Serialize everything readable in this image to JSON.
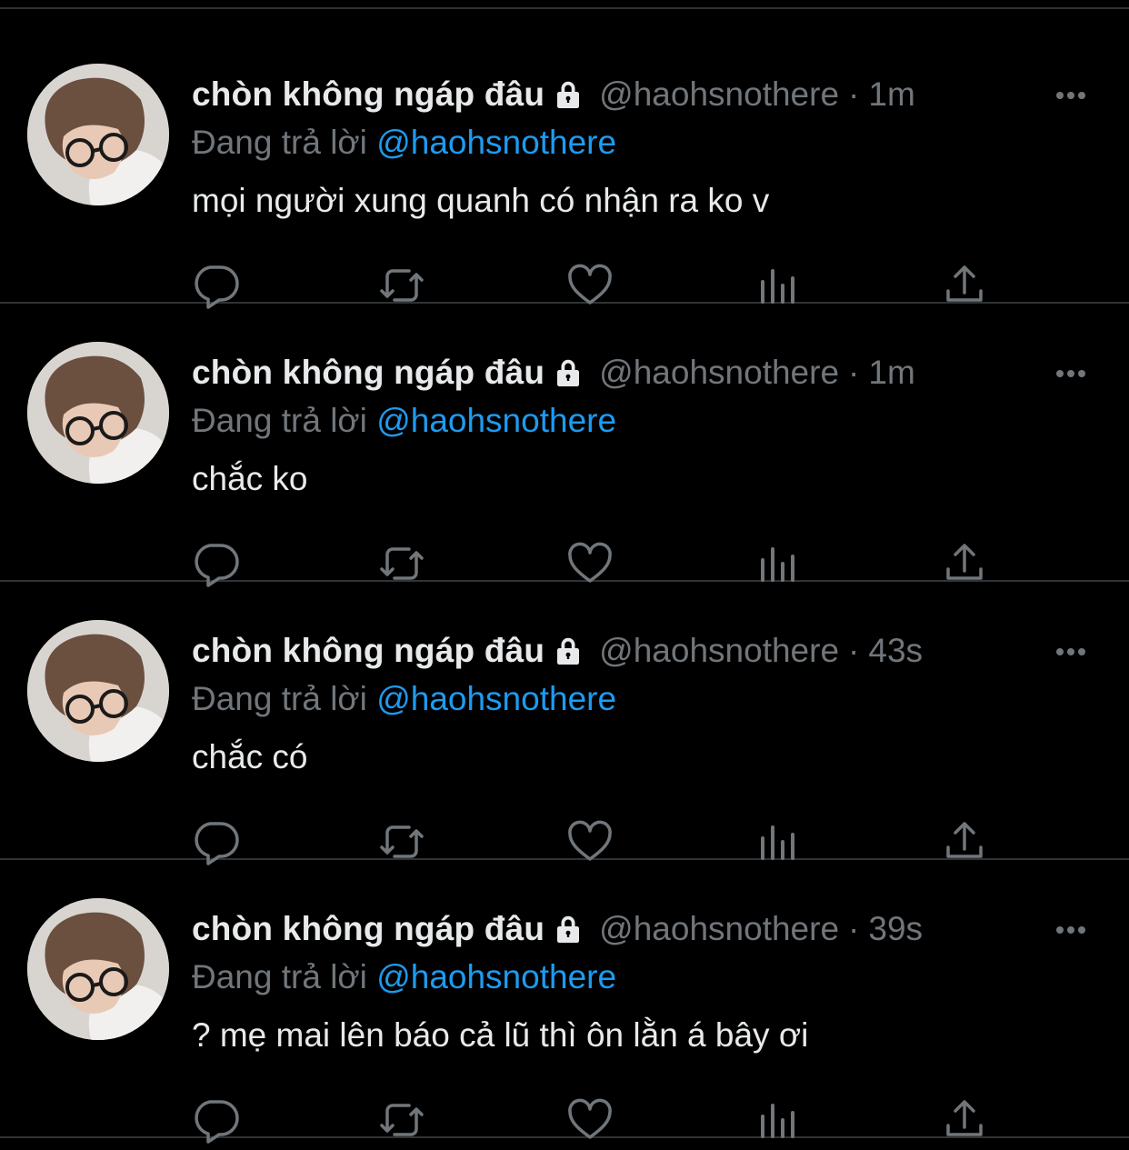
{
  "colors": {
    "background": "#000000",
    "primary_text": "#e7e9ea",
    "secondary_text": "#71767b",
    "accent": "#1d9bf0",
    "divider": "#2f3336"
  },
  "icons": {
    "more": "more-horizontal-icon",
    "lock": "lock-icon",
    "reply": "reply-bubble-icon",
    "retweet": "retweet-icon",
    "like": "heart-icon",
    "views": "views-bar-chart-icon",
    "share": "share-upload-icon"
  },
  "tweets": [
    {
      "display_name": "chòn không ngáp đâu",
      "handle": "@haohsnothere",
      "separator": "·",
      "time": "1m",
      "reply_prefix": "Đang trả lời",
      "reply_handle": "@haohsnothere",
      "text": "mọi người xung quanh có nhận ra ko v"
    },
    {
      "display_name": "chòn không ngáp đâu",
      "handle": "@haohsnothere",
      "separator": "·",
      "time": "1m",
      "reply_prefix": "Đang trả lời",
      "reply_handle": "@haohsnothere",
      "text": "chắc ko"
    },
    {
      "display_name": "chòn không ngáp đâu",
      "handle": "@haohsnothere",
      "separator": "·",
      "time": "43s",
      "reply_prefix": "Đang trả lời",
      "reply_handle": "@haohsnothere",
      "text": "chắc có"
    },
    {
      "display_name": "chòn không ngáp đâu",
      "handle": "@haohsnothere",
      "separator": "·",
      "time": "39s",
      "reply_prefix": "Đang trả lời",
      "reply_handle": "@haohsnothere",
      "text": "? mẹ mai lên báo cả lũ thì ôn lằn á bây ơi"
    }
  ]
}
